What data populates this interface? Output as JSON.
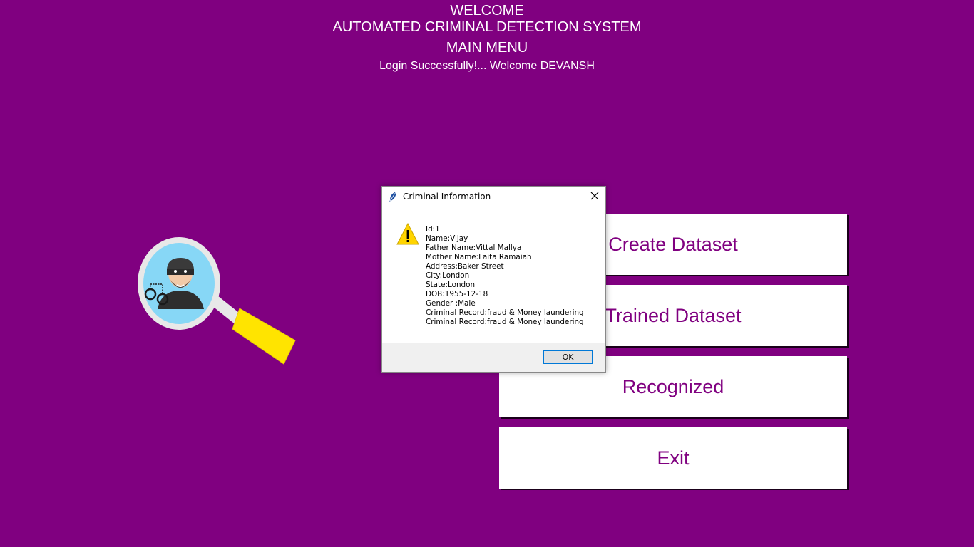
{
  "header": {
    "welcome": "WELCOME",
    "system_title": "AUTOMATED CRIMINAL DETECTION SYSTEM",
    "menu_title": "MAIN MENU",
    "login_message": "Login Successfully!... Welcome DEVANSH"
  },
  "logo": {
    "icon": "magnifier-criminal-icon"
  },
  "menu": {
    "create_dataset": "Create Dataset",
    "trained_dataset": "Trained Dataset",
    "recognized": "Recognized",
    "exit": "Exit"
  },
  "dialog": {
    "title": "Criminal Information",
    "icon": "warning-icon",
    "lines": [
      "Id:1",
      "Name:Vijay",
      "Father Name:Vittal Mallya",
      "Mother Name:Laita Ramaiah",
      "Address:Baker Street",
      "City:London",
      "State:London",
      "DOB:1955-12-18",
      "Gender :Male",
      "Criminal Record:fraud & Money laundering",
      "Criminal Record:fraud & Money laundering"
    ],
    "ok_label": "OK"
  },
  "colors": {
    "background": "#800080",
    "button_text": "#800080",
    "button_bg": "#ffffff",
    "header_text": "#ffffff"
  }
}
